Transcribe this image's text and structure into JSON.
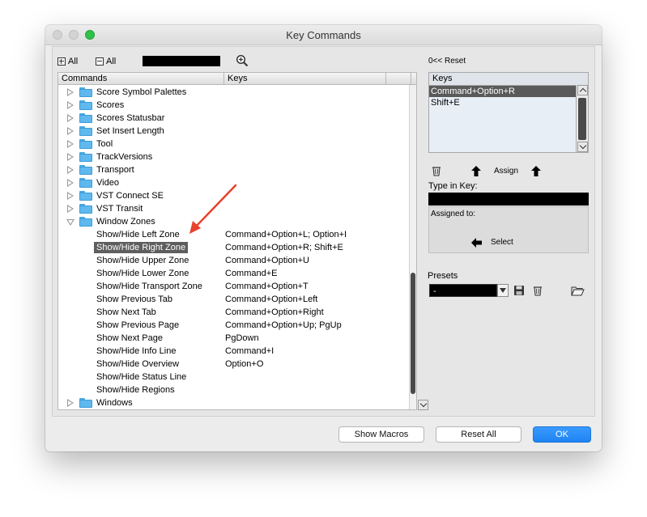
{
  "window": {
    "title": "Key Commands"
  },
  "toolbar": {
    "expand_all": "All",
    "collapse_all": "All"
  },
  "list": {
    "headers": [
      "Commands",
      "Keys"
    ],
    "rows": [
      {
        "type": "folder",
        "label": "Score Symbol Palettes",
        "state": "closed"
      },
      {
        "type": "folder",
        "label": "Scores",
        "state": "closed"
      },
      {
        "type": "folder",
        "label": "Scores Statusbar",
        "state": "closed"
      },
      {
        "type": "folder",
        "label": "Set Insert Length",
        "state": "closed"
      },
      {
        "type": "folder",
        "label": "Tool",
        "state": "closed"
      },
      {
        "type": "folder",
        "label": "TrackVersions",
        "state": "closed"
      },
      {
        "type": "folder",
        "label": "Transport",
        "state": "closed"
      },
      {
        "type": "folder",
        "label": "Video",
        "state": "closed"
      },
      {
        "type": "folder",
        "label": "VST Connect SE",
        "state": "closed"
      },
      {
        "type": "folder",
        "label": "VST Transit",
        "state": "closed"
      },
      {
        "type": "folder",
        "label": "Window Zones",
        "state": "open"
      },
      {
        "type": "cmd",
        "label": "Show/Hide Left Zone",
        "keys": "Command+Option+L; Option+I"
      },
      {
        "type": "cmd",
        "label": "Show/Hide Right Zone",
        "keys": "Command+Option+R; Shift+E",
        "selected": true
      },
      {
        "type": "cmd",
        "label": "Show/Hide Upper Zone",
        "keys": "Command+Option+U"
      },
      {
        "type": "cmd",
        "label": "Show/Hide Lower Zone",
        "keys": "Command+E"
      },
      {
        "type": "cmd",
        "label": "Show/Hide Transport Zone",
        "keys": "Command+Option+T"
      },
      {
        "type": "cmd",
        "label": "Show Previous Tab",
        "keys": "Command+Option+Left"
      },
      {
        "type": "cmd",
        "label": "Show Next Tab",
        "keys": "Command+Option+Right"
      },
      {
        "type": "cmd",
        "label": "Show Previous Page",
        "keys": "Command+Option+Up; PgUp"
      },
      {
        "type": "cmd",
        "label": "Show Next Page",
        "keys": "PgDown"
      },
      {
        "type": "cmd",
        "label": "Show/Hide Info Line",
        "keys": "Command+I"
      },
      {
        "type": "cmd",
        "label": "Show/Hide Overview",
        "keys": "Option+O"
      },
      {
        "type": "cmd",
        "label": "Show/Hide Status Line",
        "keys": ""
      },
      {
        "type": "cmd",
        "label": "Show/Hide Regions",
        "keys": ""
      },
      {
        "type": "folder",
        "label": "Windows",
        "state": "closed"
      }
    ]
  },
  "right": {
    "reset_label": "0<< Reset",
    "keys_header": "Keys",
    "keys": [
      "Command+Option+R",
      "Shift+E"
    ],
    "assign_label": "Assign",
    "type_in_key_label": "Type in Key:",
    "assigned_to_label": "Assigned to:",
    "select_label": "Select",
    "presets_label": "Presets",
    "presets_value": "-"
  },
  "footer": {
    "show_macros": "Show Macros",
    "reset_all": "Reset All",
    "ok": "OK"
  },
  "colors": {
    "accent": "#1e84f3",
    "folder": "#5fb9ee",
    "annotation_arrow": "#e8412c"
  }
}
